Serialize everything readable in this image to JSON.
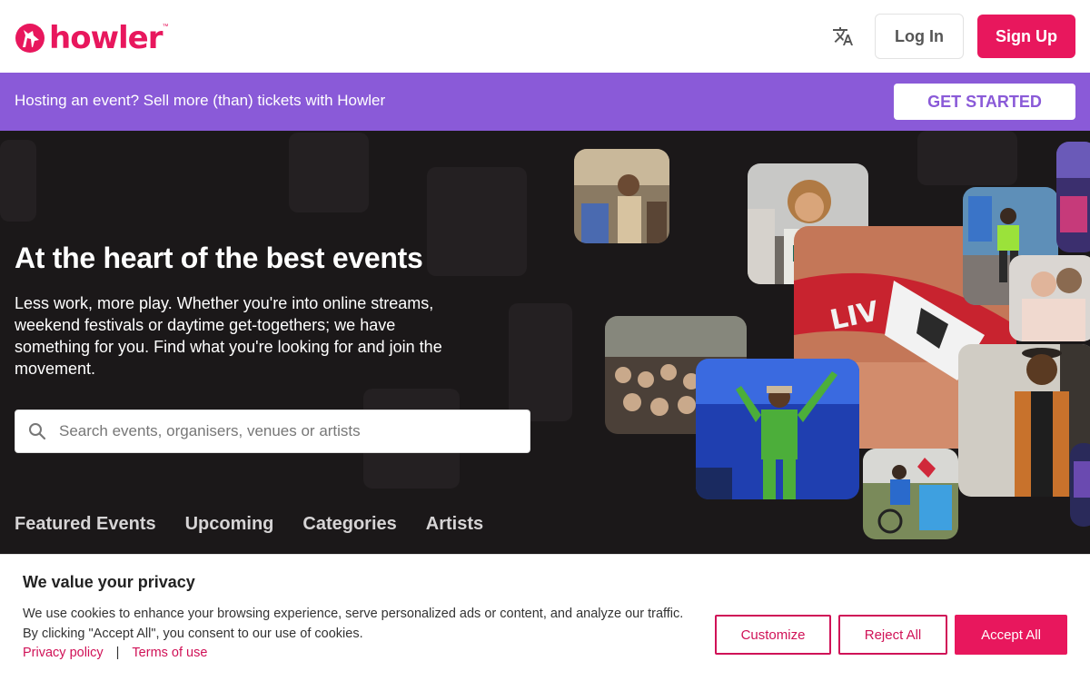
{
  "header": {
    "brand": "howler",
    "brand_tm": "™",
    "login_label": "Log In",
    "signup_label": "Sign Up"
  },
  "promo": {
    "text": "Hosting an event? Sell more (than) tickets with Howler",
    "cta_label": "GET STARTED"
  },
  "hero": {
    "title": "At the heart of the best events",
    "subtitle": "Less work, more play. Whether you're into online streams, weekend festivals or daytime get-togethers; we have something for you. Find what you're looking for and join the movement.",
    "search_placeholder": "Search events, organisers, venues or artists",
    "tabs": [
      "Featured Events",
      "Upcoming",
      "Categories",
      "Artists"
    ]
  },
  "cookie": {
    "title": "We value your privacy",
    "text": "We use cookies to enhance your browsing experience, serve personalized ads or content, and analyze our traffic. By clicking \"Accept All\", you consent to our use of cookies.",
    "privacy_label": "Privacy policy",
    "separator": "|",
    "terms_label": "Terms of use",
    "customize_label": "Customize",
    "reject_label": "Reject All",
    "accept_label": "Accept All"
  },
  "colors": {
    "brand_pink": "#e8175d",
    "promo_purple": "#8a5ad8",
    "hero_bg": "#1b1819"
  },
  "icons": [
    "howler-wolf-logo-icon",
    "translate-icon",
    "search-icon"
  ]
}
